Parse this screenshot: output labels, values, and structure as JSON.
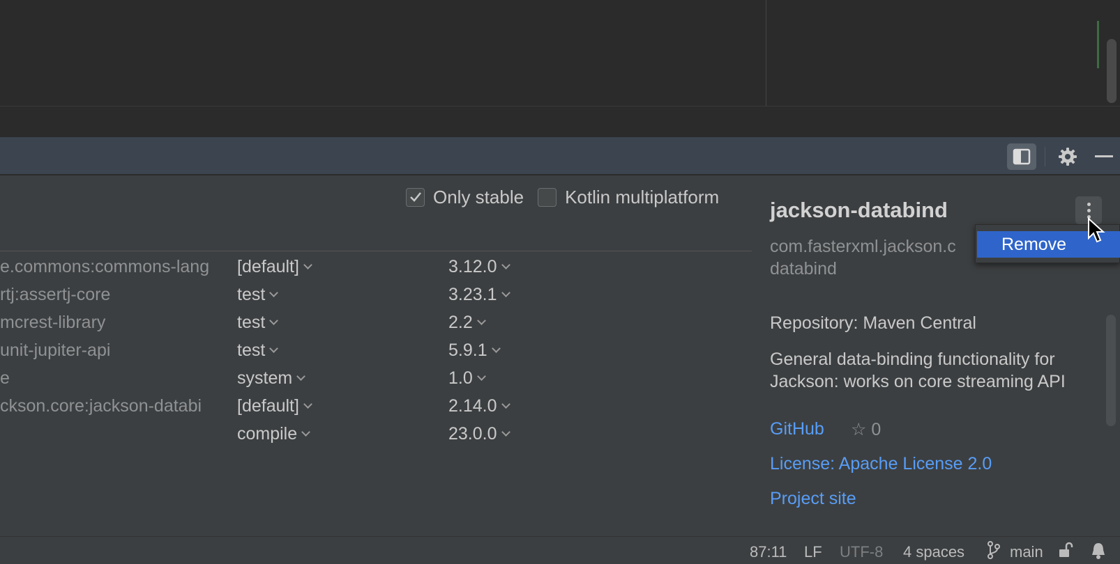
{
  "filters": {
    "only_stable": {
      "label": "Only stable",
      "checked": true
    },
    "kotlin_multiplatform": {
      "label": "Kotlin multiplatform",
      "checked": false
    }
  },
  "dependencies": [
    {
      "name": "e.commons:commons-lang",
      "scope": "[default]",
      "version": "3.12.0"
    },
    {
      "name": "rtj:assertj-core",
      "scope": "test",
      "version": "3.23.1"
    },
    {
      "name": "mcrest-library",
      "scope": "test",
      "version": "2.2"
    },
    {
      "name": "unit-jupiter-api",
      "scope": "test",
      "version": "5.9.1"
    },
    {
      "name": "e",
      "scope": "system",
      "version": "1.0"
    },
    {
      "name": "ckson.core:jackson-databi",
      "scope": "[default]",
      "version": "2.14.0"
    },
    {
      "name": "",
      "scope": "compile",
      "version": "23.0.0"
    }
  ],
  "details": {
    "title": "jackson-databind",
    "coordinates_line1": "com.fasterxml.jackson.c",
    "coordinates_line2": "databind",
    "repository": "Repository: Maven Central",
    "description": "General data-binding functionality for Jackson: works on core streaming API",
    "github_label": "GitHub",
    "stars": "☆ 0",
    "license": "License: Apache License 2.0",
    "project_site": "Project site"
  },
  "context_menu": {
    "remove_label": "Remove"
  },
  "status_bar": {
    "position": "87:11",
    "line_sep": "LF",
    "encoding": "UTF-8",
    "indent": "4 spaces",
    "branch": "main"
  },
  "colors": {
    "accent": "#2f65ca",
    "link": "#589df6",
    "header": "#3c4450",
    "panel": "#3c3f41"
  }
}
